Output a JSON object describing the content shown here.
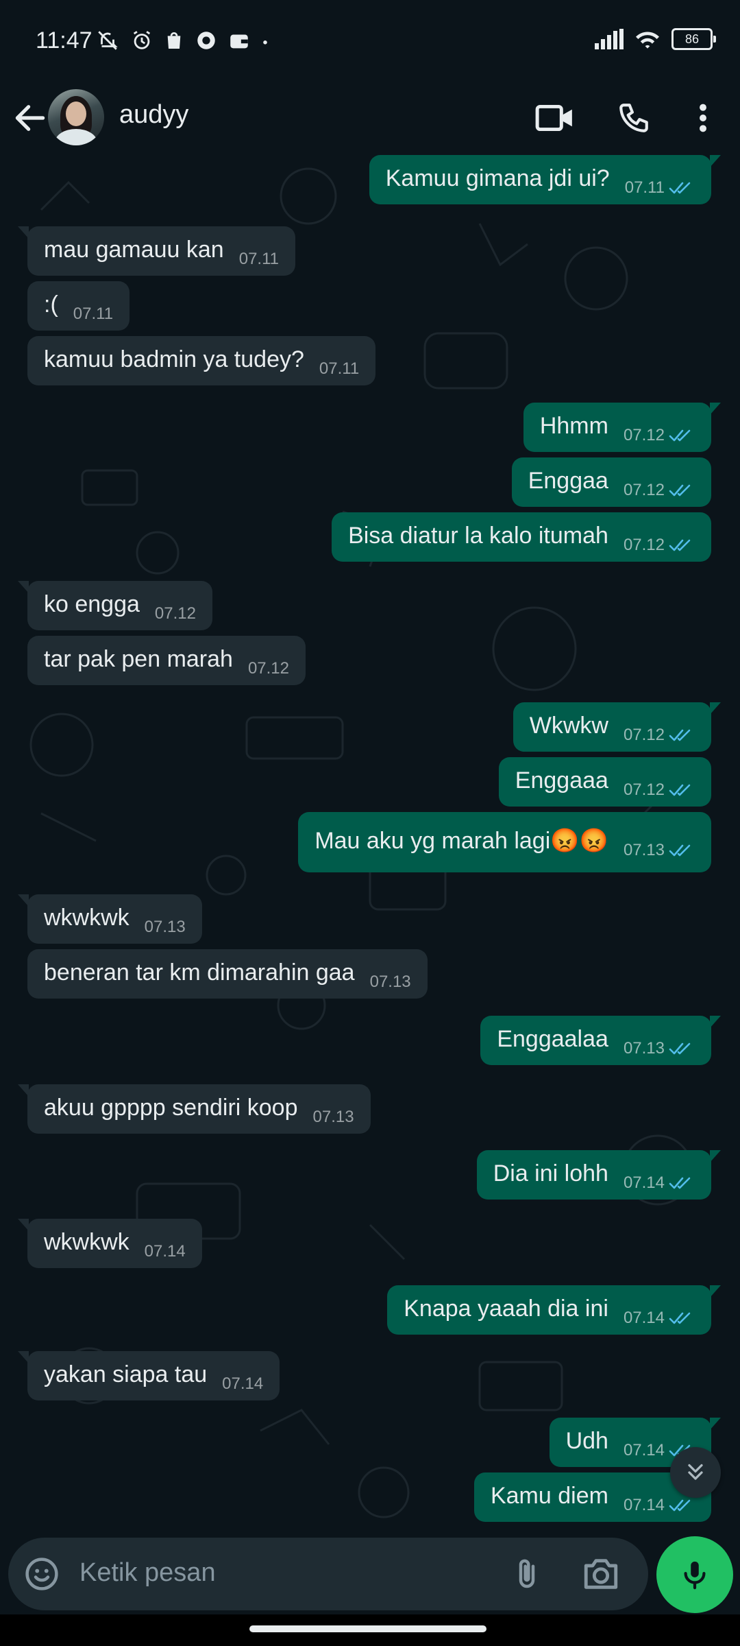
{
  "status_bar": {
    "time": "11:47",
    "battery": "86",
    "icons": [
      "mute-icon",
      "alarm-icon",
      "shop-icon",
      "vpn-icon",
      "wallet-icon",
      "dot-icon",
      "signal-icon",
      "wifi-icon",
      "battery-icon"
    ]
  },
  "header": {
    "contact_name": "audyy",
    "icons": [
      "back-arrow-icon",
      "video-call-icon",
      "voice-call-icon",
      "more-options-icon"
    ]
  },
  "messages": [
    {
      "dir": "out",
      "text": "Kamuu gimana jdi ui?",
      "time": "07.11",
      "ticks": "read"
    },
    {
      "dir": "in",
      "text": "mau gamauu kan",
      "time": "07.11"
    },
    {
      "dir": "in",
      "text": ":(",
      "time": "07.11"
    },
    {
      "dir": "in",
      "text": "kamuu badmin ya tudey?",
      "time": "07.11"
    },
    {
      "dir": "out",
      "text": "Hhmm",
      "time": "07.12",
      "ticks": "read"
    },
    {
      "dir": "out",
      "text": "Enggaa",
      "time": "07.12",
      "ticks": "read"
    },
    {
      "dir": "out",
      "text": "Bisa diatur la kalo itumah",
      "time": "07.12",
      "ticks": "read"
    },
    {
      "dir": "in",
      "text": "ko engga",
      "time": "07.12"
    },
    {
      "dir": "in",
      "text": "tar pak pen marah",
      "time": "07.12"
    },
    {
      "dir": "out",
      "text": "Wkwkw",
      "time": "07.12",
      "ticks": "read"
    },
    {
      "dir": "out",
      "text": "Enggaaa",
      "time": "07.12",
      "ticks": "read"
    },
    {
      "dir": "out",
      "text": "Mau aku yg marah lagi😡😡",
      "time": "07.13",
      "ticks": "read"
    },
    {
      "dir": "in",
      "text": "wkwkwk",
      "time": "07.13"
    },
    {
      "dir": "in",
      "text": "beneran tar km dimarahin gaa",
      "time": "07.13"
    },
    {
      "dir": "out",
      "text": "Enggaalaa",
      "time": "07.13",
      "ticks": "read"
    },
    {
      "dir": "in",
      "text": "akuu gpppp sendiri koop",
      "time": "07.13"
    },
    {
      "dir": "out",
      "text": "Dia ini lohh",
      "time": "07.14",
      "ticks": "read"
    },
    {
      "dir": "in",
      "text": "wkwkwk",
      "time": "07.14"
    },
    {
      "dir": "out",
      "text": "Knapa yaaah dia ini",
      "time": "07.14",
      "ticks": "read"
    },
    {
      "dir": "in",
      "text": "yakan siapa tau",
      "time": "07.14"
    },
    {
      "dir": "out",
      "text": "Udh",
      "time": "07.14",
      "ticks": "read"
    },
    {
      "dir": "out",
      "text": "Kamu diem",
      "time": "07.14",
      "ticks": "read"
    }
  ],
  "composer": {
    "placeholder": "Ketik pesan",
    "icons": [
      "emoji-icon",
      "attach-icon",
      "camera-icon",
      "mic-icon"
    ]
  },
  "colors": {
    "background": "#0b141a",
    "incoming_bubble": "#202c33",
    "outgoing_bubble": "#005c4b",
    "read_tick": "#53bdeb",
    "mic_button": "#21c063"
  }
}
